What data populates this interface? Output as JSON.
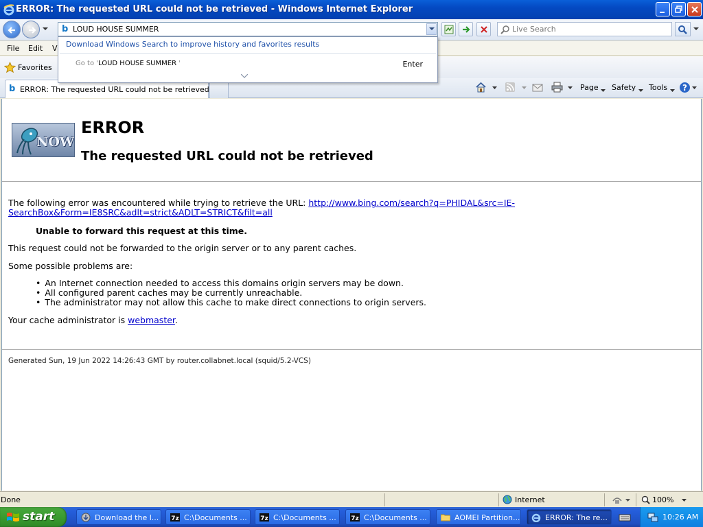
{
  "window": {
    "title": "ERROR: The requested URL could not be retrieved - Windows Internet Explorer"
  },
  "address": {
    "value": "LOUD HOUSE SUMMER",
    "search_placeholder": "Live Search"
  },
  "autocomplete": {
    "promo": "Download Windows Search to improve history and favorites results",
    "goto_prefix": "Go to '",
    "goto_query": "LOUD HOUSE SUMMER",
    "goto_suffix": " '",
    "enter_label": "Enter"
  },
  "menu": {
    "file": "File",
    "edit": "Edit",
    "view": "Vi"
  },
  "favorites": {
    "label": "Favorites"
  },
  "tab": {
    "label": "ERROR: The requested URL could not be retrieved"
  },
  "command_bar": {
    "page": "Page",
    "safety": "Safety",
    "tools": "Tools"
  },
  "page": {
    "heading": "ERROR",
    "subheading": "The requested URL could not be retrieved",
    "intro": "The following error was encountered while trying to retrieve the URL: ",
    "url_line1": "http://www.bing.com/search?q=PHIDAL&src=IE-",
    "url_line2": "SearchBox&Form=IE8SRC&adlt=strict&ADLT=STRICT&filt=all",
    "error_message": "Unable to forward this request at this time.",
    "explanation": "This request could not be forwarded to the origin server or to any parent caches.",
    "problems_heading": "Some possible problems are:",
    "problems": [
      "An Internet connection needed to access this domains origin servers may be down.",
      "All configured parent caches may be currently unreachable.",
      "The administrator may not allow this cache to make direct connections to origin servers."
    ],
    "admin_prefix": "Your cache administrator is ",
    "admin_link": "webmaster",
    "admin_suffix": ".",
    "logo_text": "NOW",
    "footer": "Generated Sun, 19 Jun 2022 14:26:43 GMT by router.collabnet.local (squid/5.2-VCS)"
  },
  "status": {
    "text": "Done",
    "zone": "Internet",
    "zoom": "100%"
  },
  "taskbar": {
    "start": "start",
    "tasks": [
      "Download the l...",
      "C:\\Documents ...",
      "C:\\Documents ...",
      "C:\\Documents ...",
      "AOMEI Partition...",
      "ERROR: The re..."
    ],
    "clock": "10:26 AM"
  },
  "colors": {
    "titlebar": "#0449c2",
    "link": "#0000cc",
    "start_green": "#3a9b30",
    "taskbar_blue": "#245edb"
  }
}
